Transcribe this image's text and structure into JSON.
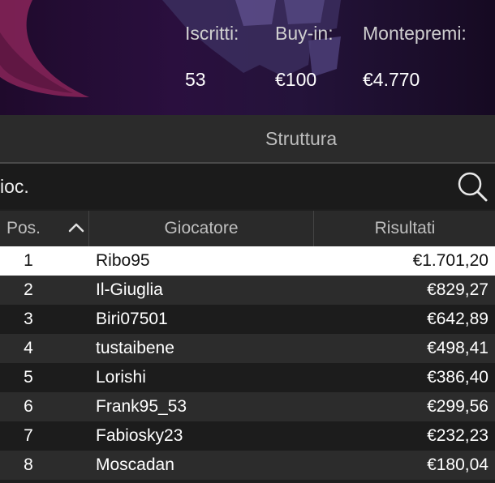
{
  "banner": {
    "stats": [
      {
        "label": "Iscritti:",
        "value": "53"
      },
      {
        "label": "Buy-in:",
        "value": "€100"
      },
      {
        "label": "Montepremi:",
        "value": "€4.770"
      }
    ]
  },
  "structure": {
    "label": "Struttura"
  },
  "search": {
    "value": "ioc.",
    "icon": "search-icon"
  },
  "table": {
    "headers": {
      "pos": "Pos.",
      "player": "Giocatore",
      "results": "Risultati"
    },
    "sort_icon": "chevron-up-icon",
    "rows": [
      {
        "pos": "1",
        "player": "Ribo95",
        "result": "€1.701,20"
      },
      {
        "pos": "2",
        "player": "Il-Giuglia",
        "result": "€829,27"
      },
      {
        "pos": "3",
        "player": "Biri07501",
        "result": "€642,89"
      },
      {
        "pos": "4",
        "player": "tustaibene",
        "result": "€498,41"
      },
      {
        "pos": "5",
        "player": "Lorishi",
        "result": "€386,40"
      },
      {
        "pos": "6",
        "player": "Frank95_53",
        "result": "€299,56"
      },
      {
        "pos": "7",
        "player": "Fabiosky23",
        "result": "€232,23"
      },
      {
        "pos": "8",
        "player": "Moscadan",
        "result": "€180,04"
      }
    ]
  },
  "colors": {
    "banner_bg": "#2a0f3e",
    "accent_magenta": "#b0306e",
    "selected_row": "#ffffff",
    "row_dark": "#1c1c1c",
    "row_alt": "#2c2c2c"
  }
}
